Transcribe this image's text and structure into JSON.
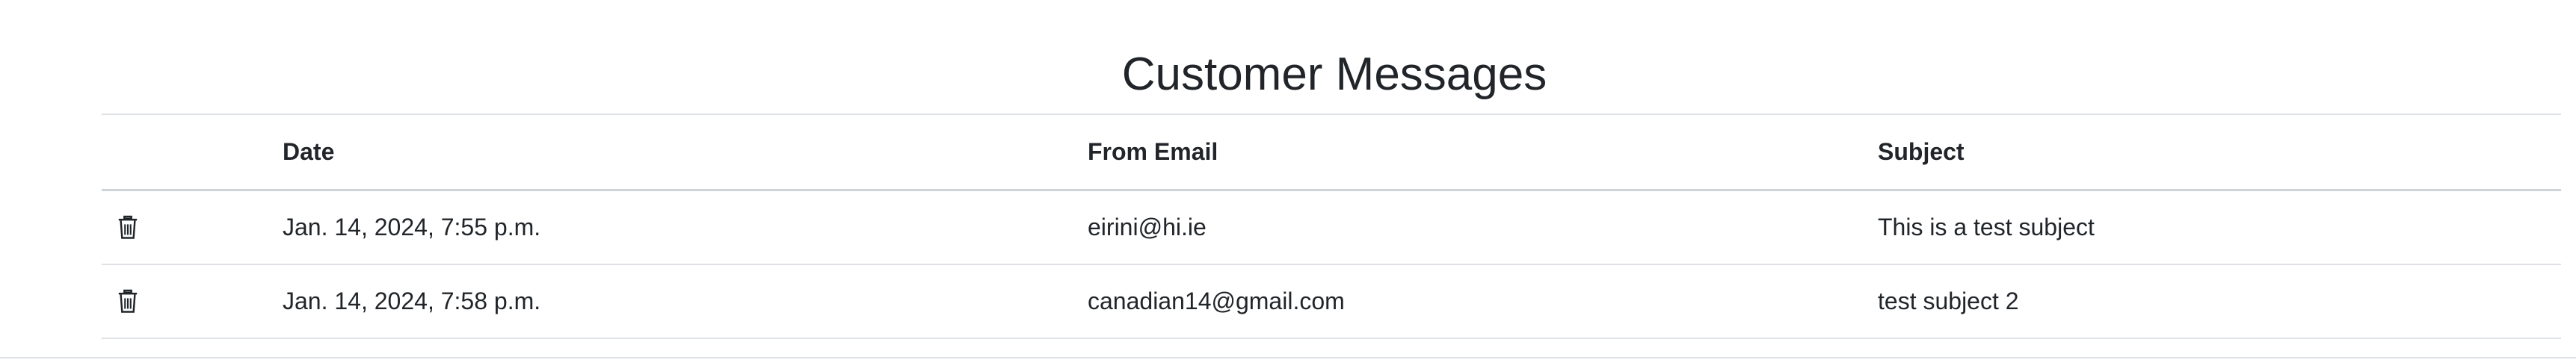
{
  "page": {
    "title": "Customer Messages"
  },
  "table": {
    "columns": {
      "date": "Date",
      "from_email": "From Email",
      "subject": "Subject"
    },
    "rows": [
      {
        "action_icon": "trash-icon",
        "date": "Jan. 14, 2024, 7:55 p.m.",
        "from_email": "eirini@hi.ie",
        "subject": "This is a test subject"
      },
      {
        "action_icon": "trash-icon",
        "date": "Jan. 14, 2024, 7:58 p.m.",
        "from_email": "canadian14@gmail.com",
        "subject": "test subject 2"
      }
    ]
  },
  "colors": {
    "text": "#212529",
    "border": "#dee2e6"
  }
}
